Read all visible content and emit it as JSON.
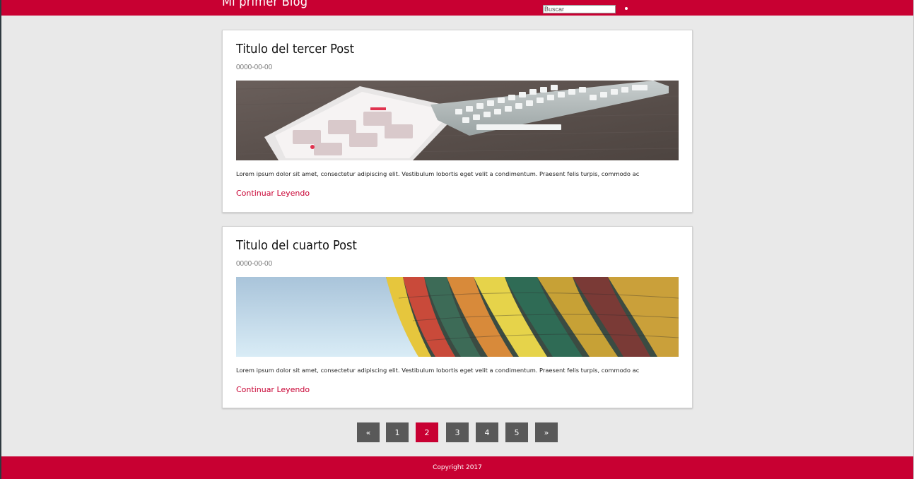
{
  "header": {
    "site_title": "Mi primer Blog",
    "search_placeholder": "Buscar"
  },
  "posts": [
    {
      "title": "Titulo del tercer Post",
      "date": "0000-00-00",
      "image": "tablet-calendar-keyboard-photo",
      "excerpt": "Lorem ipsum dolor sit amet, consectetur adipiscing elit. Vestibulum lobortis eget velit a condimentum. Praesent felis turpis, commodo ac",
      "read_more": "Continuar Leyendo"
    },
    {
      "title": "Titulo del cuarto Post",
      "date": "0000-00-00",
      "image": "hot-air-balloon-photo",
      "excerpt": "Lorem ipsum dolor sit amet, consectetur adipiscing elit. Vestibulum lobortis eget velit a condimentum. Praesent felis turpis, commodo ac",
      "read_more": "Continuar Leyendo"
    }
  ],
  "pagination": {
    "prev": "«",
    "pages": [
      "1",
      "2",
      "3",
      "4",
      "5"
    ],
    "active": "2",
    "next": "»"
  },
  "footer": {
    "copyright": "Copyright 2017"
  },
  "colors": {
    "brand": "#c80032",
    "page_bg": "#e9e9e9",
    "pager": "#595959"
  }
}
